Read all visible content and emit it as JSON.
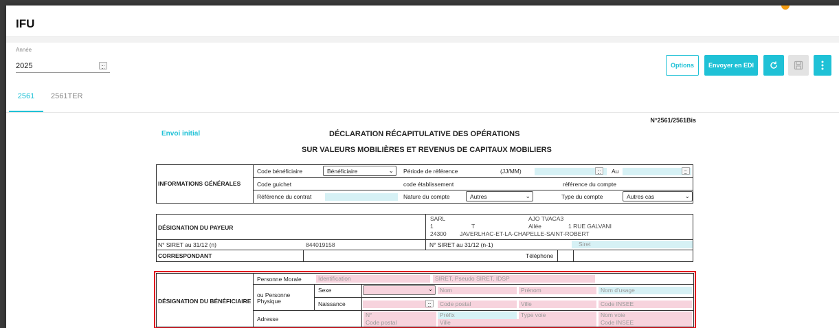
{
  "app": {
    "title": "IFU"
  },
  "toolbar": {
    "year_label": "Année",
    "year_value": "2025",
    "options_label": "Options",
    "edi_label": "Envoyer en EDI"
  },
  "tabs": [
    {
      "label": "2561"
    },
    {
      "label": "2561TER"
    }
  ],
  "form": {
    "number": "N°2561/2561Bis",
    "envoi": "Envoi initial",
    "title1": "DÉCLARATION RÉCAPITULATIVE DES OPÉRATIONS",
    "title2": "SUR VALEURS MOBILIÈRES ET REVENUS DE CAPITAUX MOBILIERS"
  },
  "info": {
    "section": "INFORMATIONS GÉNÉRALES",
    "code_beneficiaire": "Code bénéficiaire",
    "code_beneficiaire_value": "Bénéficiaire",
    "periode": "Période de référence",
    "jjmm": "(JJ/MM)",
    "au": "Au",
    "code_guichet": "Code guichet",
    "code_etablissement": "code établissement",
    "reference_compte": "référence du compte",
    "reference_contrat": "Référence du contrat",
    "nature_compte": "Nature du compte",
    "nature_value": "Autres",
    "type_compte": "Type du compte",
    "type_value": "Autres cas"
  },
  "payeur": {
    "section": "DÉSIGNATION DU PAYEUR",
    "forme": "SARL",
    "nom": "AJO TVACA3",
    "num": "1",
    "indice": "T",
    "voie_type": "Allée",
    "voie": "1 RUE GALVANI",
    "cp": "24300",
    "ville": "JAVERLHAC-ET-LA-CHAPELLE-SAINT-ROBERT",
    "siret_label": "N° SIRET au 31/12 (n)",
    "siret_value": "844019158",
    "siret_prev_label": "N° SIRET au 31/12 (n-1)",
    "siret_prev_placeholder": "Siret",
    "correspondant": "CORRESPONDANT",
    "telephone": "Téléphone"
  },
  "beneficiaire": {
    "section": "DÉSIGNATION DU BÉNÉFICIAIRE",
    "personne_morale": "Personne Morale",
    "identification": "Identification",
    "siret_ph": "SIRET, Pseudo SIRET, IDSP",
    "ou_personne": "ou Personne",
    "physique": "Physique",
    "sexe": "Sexe",
    "nom": "Nom",
    "prenom": "Prénom",
    "nom_usage": "Nom d'usage",
    "naissance": "Naissance",
    "code_postal": "Code postal",
    "ville": "Ville",
    "code_insee": "Code INSEE",
    "adresse": "Adresse",
    "no": "N°",
    "prefix": "Préfix",
    "type_voie": "Type voie",
    "nom_voie": "Nom voie"
  }
}
